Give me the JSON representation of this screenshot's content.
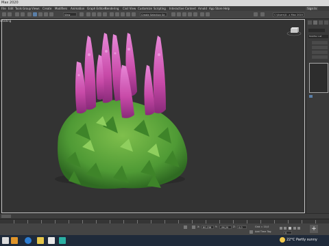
{
  "window": {
    "title": "Max 2020"
  },
  "menu": {
    "items": [
      "File",
      "Edit",
      "Tools",
      "Group",
      "Views",
      "Create",
      "Modifiers",
      "Animation",
      "Graph Editors",
      "Rendering",
      "Civil View",
      "Customize",
      "Scripting",
      "Interactive",
      "Content",
      "Arnold",
      "App Store",
      "Help"
    ],
    "sign_in": "Sign In"
  },
  "toolbar": {
    "view_dropdown": "View",
    "selection_set": "Create Selection Se",
    "project_path": "C:\\Users\\U...s Max 2020"
  },
  "viewport": {
    "label": "Shading",
    "scene_object": "flowering plant"
  },
  "command_panel": {
    "modifier_list": "Modifier List"
  },
  "status": {
    "x_label": "X:",
    "x_value": "80,238",
    "y_label": "Y:",
    "y_value": "-96,20",
    "z_label": "Z:",
    "z_value": "0,0",
    "grid": "Grid = 10,0",
    "add_time_tag": "Add Time Tag",
    "frame": "0"
  },
  "taskbar": {
    "weather": "22°C",
    "weather_desc": "Partly sunny"
  }
}
